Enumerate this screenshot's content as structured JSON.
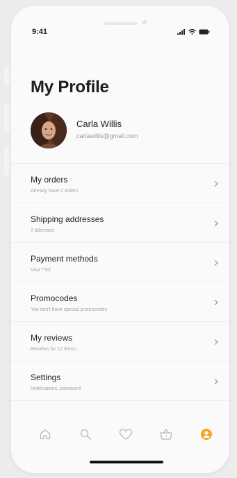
{
  "status_bar": {
    "time": "9:41",
    "icons": [
      "signal-icon",
      "wifi-icon",
      "battery-icon"
    ]
  },
  "page": {
    "title": "My Profile"
  },
  "user": {
    "name": "Carla Willis",
    "email": "carlawillis@gmail.com"
  },
  "menu": [
    {
      "title": "My orders",
      "subtitle": "Already have 2 orders"
    },
    {
      "title": "Shipping addresses",
      "subtitle": "2 ddresses"
    },
    {
      "title": "Payment methods",
      "subtitle": "Visa **83"
    },
    {
      "title": "Promocodes",
      "subtitle": "You don't have special promocodes"
    },
    {
      "title": "My reviews",
      "subtitle": "Reviews for 12 items"
    },
    {
      "title": "Settings",
      "subtitle": "Notifications, password"
    }
  ],
  "tabs": [
    {
      "icon": "home-icon",
      "active": false
    },
    {
      "icon": "search-icon",
      "active": false
    },
    {
      "icon": "heart-icon",
      "active": false
    },
    {
      "icon": "basket-icon",
      "active": false
    },
    {
      "icon": "profile-icon",
      "active": true
    }
  ],
  "colors": {
    "accent": "#F5A623",
    "icon_inactive": "#b9b9b9",
    "text_primary": "#222222",
    "text_secondary": "#9a9a9a"
  }
}
